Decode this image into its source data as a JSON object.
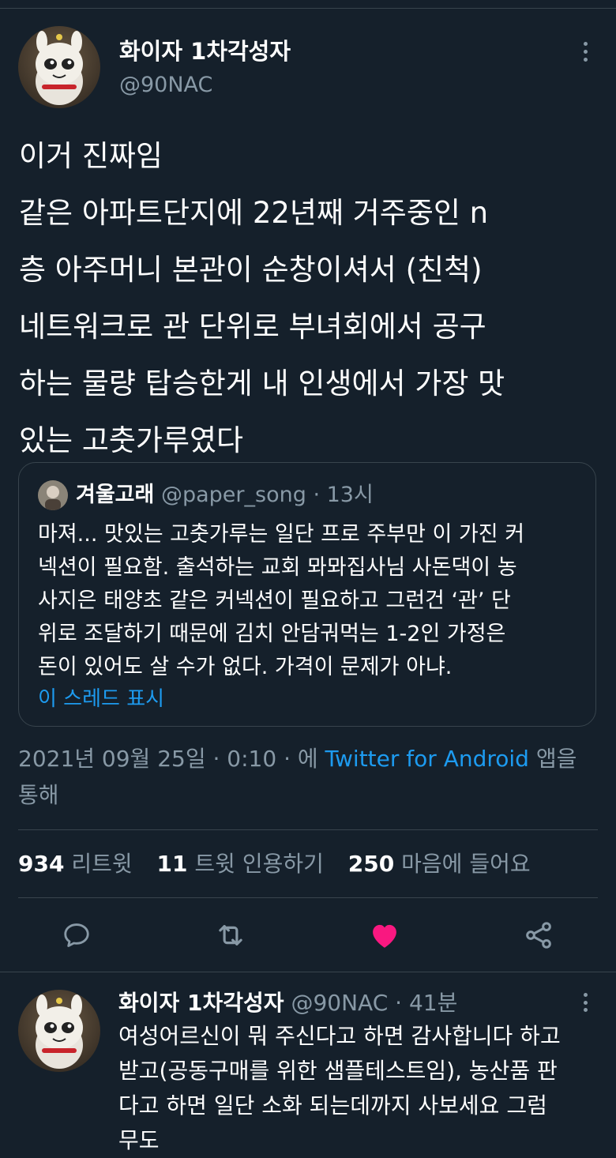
{
  "main_tweet": {
    "display_name": "화이자 1차각성자",
    "handle": "@90NAC",
    "text_lines": [
      "이거 진짜임",
      "같은 아파트단지에 22년째 거주중인 n",
      "층 아주머니 본관이 순창이셔서 (친척)",
      "네트워크로 관 단위로 부녀회에서 공구",
      "하는 물량 탑승한게 내 인생에서 가장 맛",
      "있는 고춧가루였다"
    ],
    "quote": {
      "display_name": "겨울고래",
      "handle": "@paper_song",
      "dot": "·",
      "time": "13시",
      "text_lines": [
        "마져... 맛있는 고춧가루는 일단 프로 주부만 이 가진 커",
        "넥션이 필요함. 출석하는 교회 뫄뫄집사님 사돈댁이 농",
        "사지은 태양초 같은 커넥션이 필요하고 그런건 ‘관’ 단",
        "위로 조달하기 때문에 김치 안담궈먹는 1-2인 가정은",
        "돈이 있어도 살 수가 없다. 가격이 문제가 아냐."
      ],
      "show_thread": "이 스레드 표시"
    },
    "meta": {
      "date_time": "2021년 09월 25일 · 0:10 · 에",
      "source": "Twitter for Android",
      "suffix_line1": "앱을",
      "suffix_line2": "통해"
    },
    "stats": {
      "retweets_count": "934",
      "retweets_label": "리트윗",
      "quotes_count": "11",
      "quotes_label": "트윗 인용하기",
      "likes_count": "250",
      "likes_label": "마음에 들어요"
    },
    "actions": [
      {
        "name": "reply",
        "icon": "reply-icon"
      },
      {
        "name": "retweet",
        "icon": "retweet-icon"
      },
      {
        "name": "like",
        "icon": "heart-icon",
        "liked": true
      },
      {
        "name": "share",
        "icon": "share-icon"
      }
    ]
  },
  "reply_tweet": {
    "display_name": "화이자 1차각성자",
    "handle": "@90NAC",
    "dot": "·",
    "time": "41분",
    "text_lines": [
      "여성어르신이 뭐 주신다고 하면 감사합니다 하고",
      "받고(공동구매를 위한 샘플테스트임), 농산품 판",
      "다고 하면 일단 소화 되는데까지 사보세요 그럼",
      "무도"
    ]
  },
  "colors": {
    "background": "#15202b",
    "divider": "#38444d",
    "secondary_text": "#8899a6",
    "link": "#1d9bf0",
    "like": "#f91880"
  }
}
